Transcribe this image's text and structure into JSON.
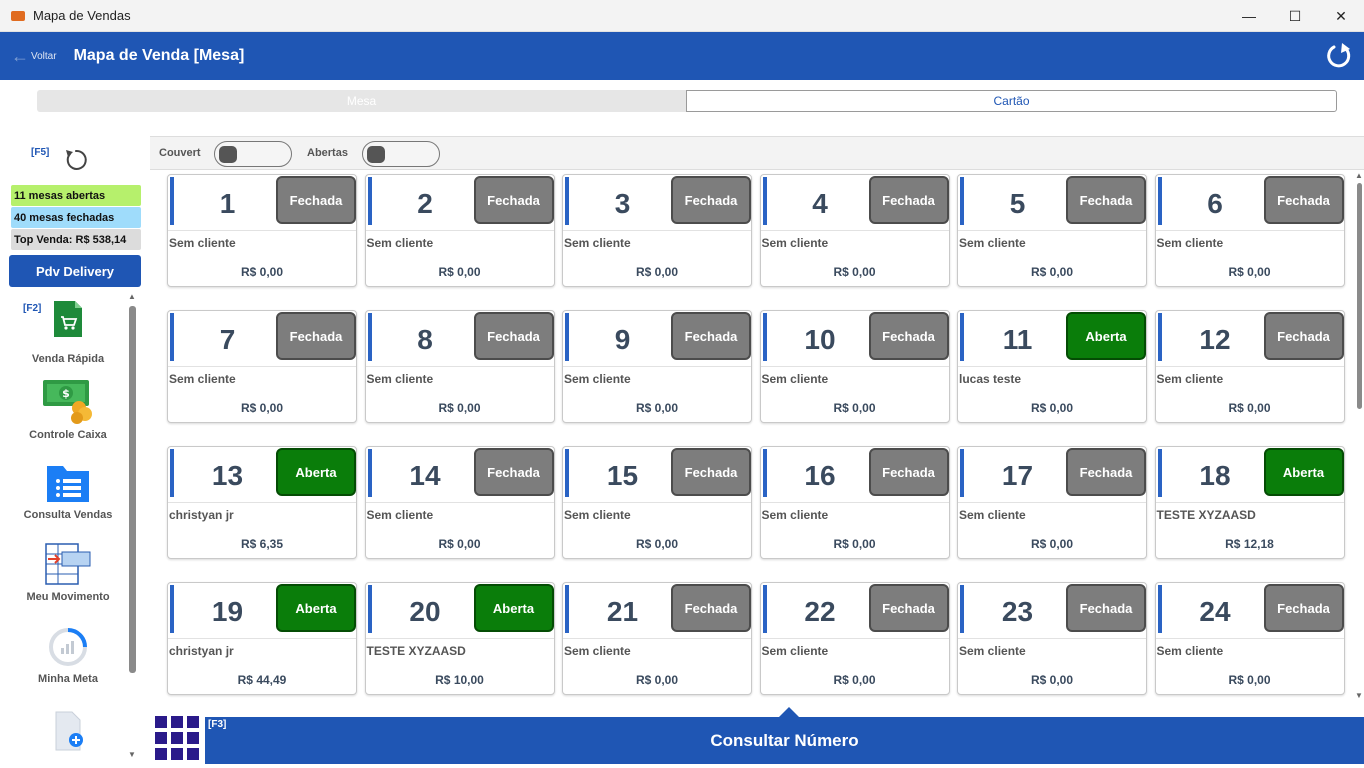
{
  "window": {
    "title": "Mapa de Vendas",
    "min": "—",
    "max": "☐",
    "close": "✕"
  },
  "header": {
    "back_label": "Voltar",
    "back_icon": "←",
    "title": "Mapa de Venda [Mesa]"
  },
  "tabs": [
    {
      "label": "Mesa",
      "active": false
    },
    {
      "label": "Cartão",
      "active": true
    }
  ],
  "sidebar": {
    "refresh_key": "[F5]",
    "stats": {
      "abertas": "11 mesas abertas",
      "fechadas": "40 mesas fechadas",
      "top": "Top Venda: R$ 538,14"
    },
    "pdv_delivery": "Pdv Delivery",
    "venda_key": "[F2]",
    "items": [
      {
        "label": "Venda Rápida",
        "icon": "shopping-cart-icon"
      },
      {
        "label": "Controle Caixa",
        "icon": "money-icon"
      },
      {
        "label": "Consulta Vendas",
        "icon": "list-folder-icon"
      },
      {
        "label": "Meu Movimento",
        "icon": "spreadsheet-icon"
      },
      {
        "label": "Minha Meta",
        "icon": "goal-chart-icon"
      },
      {
        "label": "",
        "icon": "new-document-icon"
      }
    ]
  },
  "filters": {
    "couvert": "Couvert",
    "abertas": "Abertas"
  },
  "tables": [
    {
      "num": "1",
      "status": "Fechada",
      "client": "Sem cliente",
      "value": "R$ 0,00"
    },
    {
      "num": "2",
      "status": "Fechada",
      "client": "Sem cliente",
      "value": "R$ 0,00"
    },
    {
      "num": "3",
      "status": "Fechada",
      "client": "Sem cliente",
      "value": "R$ 0,00"
    },
    {
      "num": "4",
      "status": "Fechada",
      "client": "Sem cliente",
      "value": "R$ 0,00"
    },
    {
      "num": "5",
      "status": "Fechada",
      "client": "Sem cliente",
      "value": "R$ 0,00"
    },
    {
      "num": "6",
      "status": "Fechada",
      "client": "Sem cliente",
      "value": "R$ 0,00"
    },
    {
      "num": "7",
      "status": "Fechada",
      "client": "Sem cliente",
      "value": "R$ 0,00"
    },
    {
      "num": "8",
      "status": "Fechada",
      "client": "Sem cliente",
      "value": "R$ 0,00"
    },
    {
      "num": "9",
      "status": "Fechada",
      "client": "Sem cliente",
      "value": "R$ 0,00"
    },
    {
      "num": "10",
      "status": "Fechada",
      "client": "Sem cliente",
      "value": "R$ 0,00"
    },
    {
      "num": "11",
      "status": "Aberta",
      "client": "lucas teste",
      "value": "R$ 0,00"
    },
    {
      "num": "12",
      "status": "Fechada",
      "client": "Sem cliente",
      "value": "R$ 0,00"
    },
    {
      "num": "13",
      "status": "Aberta",
      "client": "christyan jr",
      "value": "R$ 6,35"
    },
    {
      "num": "14",
      "status": "Fechada",
      "client": "Sem cliente",
      "value": "R$ 0,00"
    },
    {
      "num": "15",
      "status": "Fechada",
      "client": "Sem cliente",
      "value": "R$ 0,00"
    },
    {
      "num": "16",
      "status": "Fechada",
      "client": "Sem cliente",
      "value": "R$ 0,00"
    },
    {
      "num": "17",
      "status": "Fechada",
      "client": "Sem cliente",
      "value": "R$ 0,00"
    },
    {
      "num": "18",
      "status": "Aberta",
      "client": "TESTE XYZAASD",
      "value": "R$ 12,18"
    },
    {
      "num": "19",
      "status": "Aberta",
      "client": "christyan jr",
      "value": "R$ 44,49"
    },
    {
      "num": "20",
      "status": "Aberta",
      "client": "TESTE XYZAASD",
      "value": "R$ 10,00"
    },
    {
      "num": "21",
      "status": "Fechada",
      "client": "Sem cliente",
      "value": "R$ 0,00"
    },
    {
      "num": "22",
      "status": "Fechada",
      "client": "Sem cliente",
      "value": "R$ 0,00"
    },
    {
      "num": "23",
      "status": "Fechada",
      "client": "Sem cliente",
      "value": "R$ 0,00"
    },
    {
      "num": "24",
      "status": "Fechada",
      "client": "Sem cliente",
      "value": "R$ 0,00"
    }
  ],
  "bottom": {
    "key": "[F3]",
    "label": "Consultar Número"
  },
  "colors": {
    "primary": "#1f56b4",
    "open": "#0a7d0a",
    "closed": "#7d7d7d",
    "stat_open": "#b6f06c",
    "stat_closed": "#9fdcfb",
    "stat_top": "#dcdcdc"
  }
}
